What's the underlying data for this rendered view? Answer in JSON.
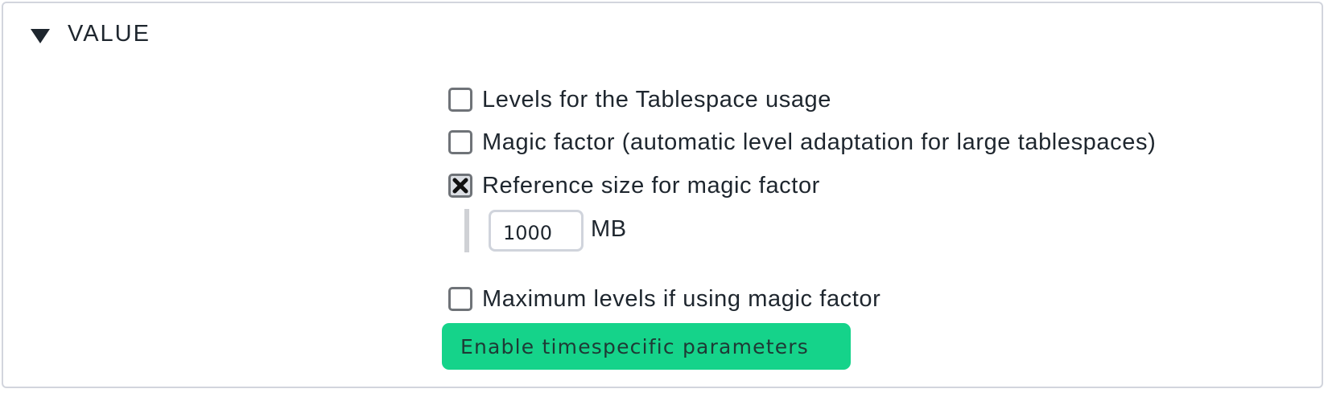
{
  "section": {
    "title": "VALUE",
    "collapse_icon": "triangle-down-icon"
  },
  "options": [
    {
      "label": "Levels for the Tablespace usage",
      "checked": false
    },
    {
      "label": "Magic factor (automatic level adaptation for large tablespaces)",
      "checked": false
    },
    {
      "label": "Reference size for magic factor",
      "checked": true
    },
    {
      "label": "Maximum levels if using magic factor",
      "checked": false
    }
  ],
  "reference_size": {
    "value": "1000",
    "unit": "MB"
  },
  "enable_button": {
    "label": "Enable timespecific parameters",
    "color": "#15d38a"
  }
}
